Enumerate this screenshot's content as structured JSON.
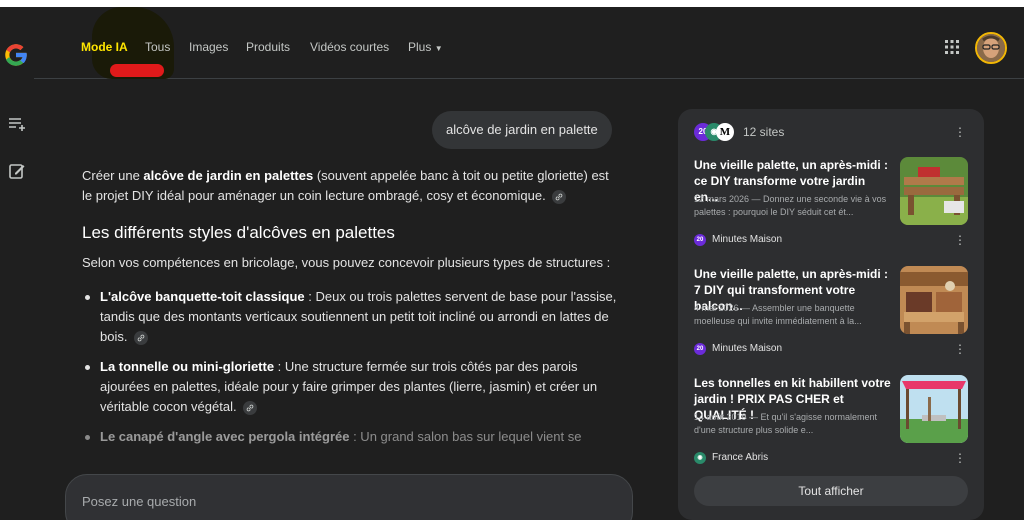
{
  "nav": {
    "tabs": [
      {
        "label": "Mode IA"
      },
      {
        "label": "Tous"
      },
      {
        "label": "Images"
      },
      {
        "label": "Produits"
      },
      {
        "label": "Vidéos courtes"
      },
      {
        "label": "Plus"
      }
    ]
  },
  "query": "alcôve de jardin en palette",
  "answer": {
    "intro_1": "Créer une ",
    "intro_bold": "alcôve de jardin en palettes",
    "intro_2": " (souvent appelée banc à toit ou petite gloriette) est le projet DIY idéal pour aménager un coin lecture ombragé, cosy et économique.",
    "heading": "Les différents styles d'alcôves en palettes",
    "lead": "Selon vos compétences en bricolage, vous pouvez concevoir plusieurs types de structures :",
    "bullets": [
      {
        "bold": "L'alcôve banquette-toit classique",
        "text": " : Deux ou trois palettes servent de base pour l'assise, tandis que des montants verticaux soutiennent un petit toit incliné ou arrondi en lattes de bois."
      },
      {
        "bold": "La tonnelle ou mini-gloriette",
        "text": " : Une structure fermée sur trois côtés par des parois ajourées en palettes, idéale pour y faire grimper des plantes (lierre, jasmin) et créer un véritable cocon végétal."
      },
      {
        "bold": "Le canapé d'angle avec pergola intégrée",
        "text": " : Un grand salon bas sur lequel vient se"
      }
    ]
  },
  "ask": {
    "placeholder": "Posez une question"
  },
  "sources": {
    "count_label": "12 sites",
    "cards": [
      {
        "title": "Une vieille palette, un après-midi : ce DIY transforme votre jardin en...",
        "snippet": "12 mars 2026 — Donnez une seconde vie à vos palettes : pourquoi le DIY séduit cet ét...",
        "site": "Minutes Maison",
        "site_badge": "20"
      },
      {
        "title": "Une vieille palette, un après-midi : 7 DIY qui transforment votre balcon...",
        "snippet": "4 mai 2026 — Assembler une banquette moelleuse qui invite immédiatement à la...",
        "site": "Minutes Maison",
        "site_badge": "20"
      },
      {
        "title": "Les tonnelles en kit habillent votre jardin ! PRIX PAS CHER et QUALITÉ !",
        "snippet": "14 août 2019 — Et qu'il s'agisse normalement d'une structure plus solide e...",
        "site": "France Abris",
        "site_badge": ""
      }
    ],
    "show_all": "Tout afficher"
  },
  "colors": {
    "background": "#1f1f1f",
    "panel": "#2d2e30",
    "highlight_text": "#ffe600",
    "highlight_mark": "#e11a1a"
  }
}
